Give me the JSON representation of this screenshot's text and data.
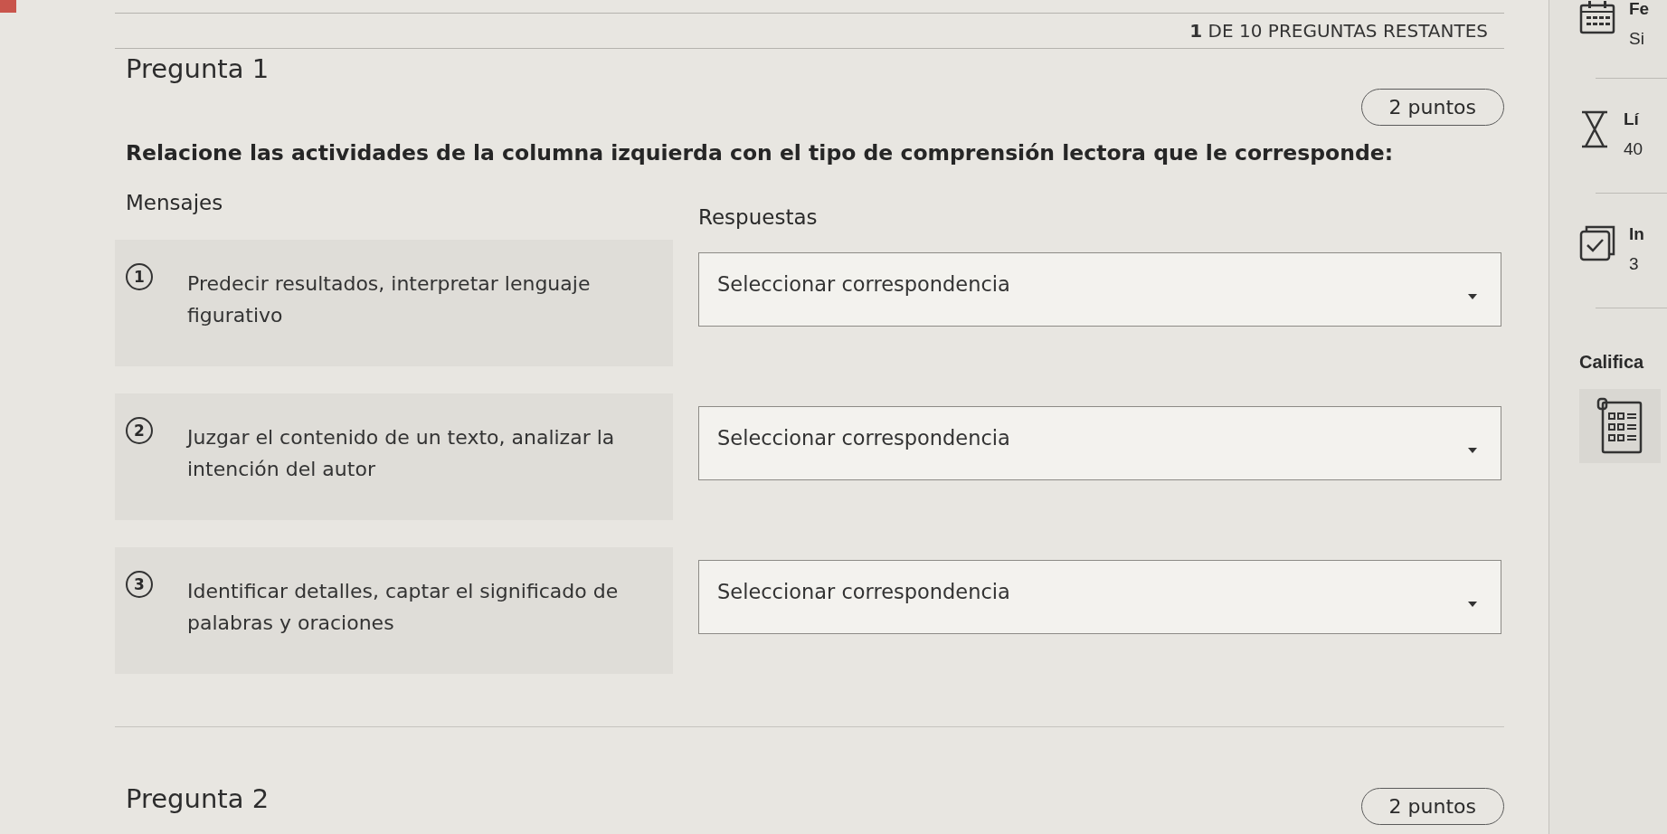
{
  "header": {
    "progress": "**1** DE 10 PREGUNTAS RESTANTES"
  },
  "question": {
    "title": "Pregunta 1",
    "points": "2 puntos",
    "prompt": "Relacione las actividades de la columna izquierda con el tipo de comprensión lectora que le corresponde:",
    "left_heading": "Mensajes",
    "right_heading": "Respuestas",
    "pairs": [
      {
        "number": "1",
        "text": "Predecir resultados, interpretar lenguaje figurativo",
        "answer": {
          "placeholder": "Seleccionar correspondencia"
        }
      },
      {
        "number": "2",
        "text": "Juzgar el contenido de un texto, analizar la intención del autor",
        "answer": {
          "placeholder": "Seleccionar correspondencia"
        }
      },
      {
        "number": "3",
        "text": "Identificar detalles, captar el significado de palabras y oraciones",
        "answer": {
          "placeholder": "Seleccionar correspondencia"
        }
      }
    ]
  },
  "next_question": {
    "title": "Pregunta 2",
    "points": "2 puntos"
  },
  "sidebar": {
    "items": [
      {
        "kind": "due_date",
        "title": "Fe",
        "detail": "Si"
      },
      {
        "kind": "time_limit",
        "title": "Lí",
        "detail": "40"
      },
      {
        "kind": "attempts",
        "title": "In",
        "detail": "3"
      }
    ],
    "grading": {
      "title": "Califica"
    }
  }
}
